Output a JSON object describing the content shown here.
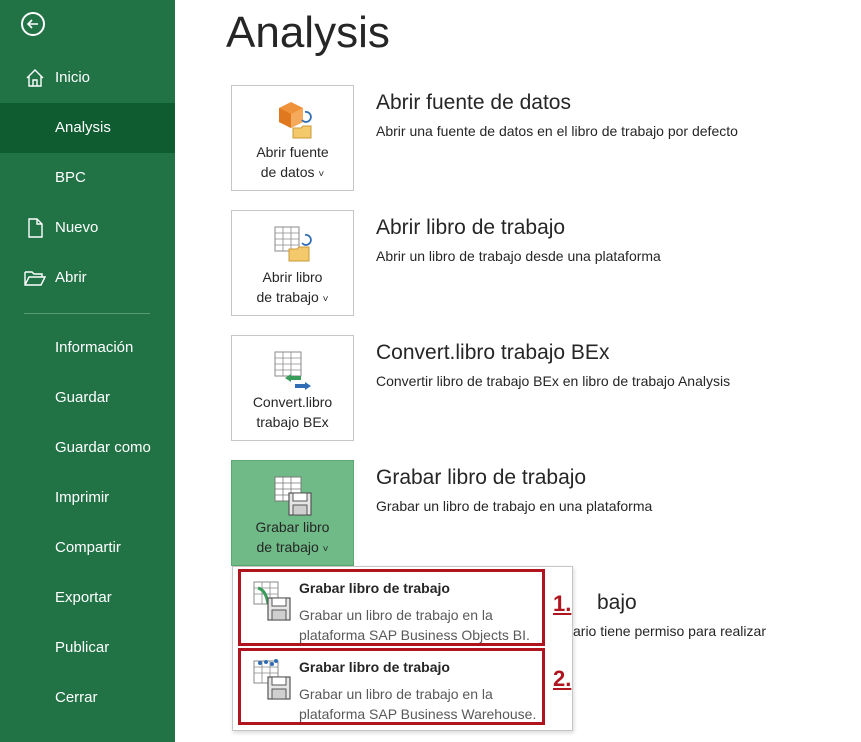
{
  "page_title": "Analysis",
  "sidebar": {
    "back_label": "",
    "items": [
      {
        "label": "Inicio",
        "icon": "home-icon"
      },
      {
        "label": "Analysis",
        "active": true
      },
      {
        "label": "BPC"
      },
      {
        "label": "Nuevo",
        "icon": "new-file-icon"
      },
      {
        "label": "Abrir",
        "icon": "folder-open-icon"
      },
      {
        "label": "Información"
      },
      {
        "label": "Guardar"
      },
      {
        "label": "Guardar como"
      },
      {
        "label": "Imprimir"
      },
      {
        "label": "Compartir"
      },
      {
        "label": "Exportar"
      },
      {
        "label": "Publicar"
      },
      {
        "label": "Cerrar"
      }
    ]
  },
  "actions": [
    {
      "tile_line1": "Abrir fuente",
      "tile_line2": "de datos",
      "has_caret": true,
      "title": "Abrir fuente de datos",
      "desc": "Abrir una fuente de datos en el libro de trabajo por defecto",
      "icon": "open-data-source-icon"
    },
    {
      "tile_line1": "Abrir libro",
      "tile_line2": "de trabajo",
      "has_caret": true,
      "title": "Abrir libro de trabajo",
      "desc": "Abrir un libro de trabajo desde una plataforma",
      "icon": "open-workbook-icon"
    },
    {
      "tile_line1": "Convert.libro",
      "tile_line2": "trabajo BEx",
      "has_caret": false,
      "title": "Convert.libro trabajo BEx",
      "desc": "Convertir libro de trabajo BEx en libro de trabajo Analysis",
      "icon": "convert-workbook-icon"
    },
    {
      "tile_line1": "Grabar libro",
      "tile_line2": "de trabajo",
      "has_caret": true,
      "title": "Grabar libro de trabajo",
      "desc": "Grabar un libro de trabajo en una plataforma",
      "icon": "save-workbook-icon",
      "selected": true
    }
  ],
  "hidden_action": {
    "title_fragment": "bajo",
    "desc_fragment": "ario tiene permiso para realizar"
  },
  "caret_glyph": "˅",
  "dropdown": {
    "items": [
      {
        "title": "Grabar libro de trabajo",
        "desc_line1": "Grabar un libro de trabajo en la",
        "desc_line2": "plataforma SAP Business Objects BI.",
        "marker": "1.",
        "icon": "save-bi-platform-icon"
      },
      {
        "title": "Grabar libro de trabajo",
        "desc_line1": "Grabar un libro de trabajo en la",
        "desc_line2": "plataforma SAP Business Warehouse.",
        "marker": "2.",
        "icon": "save-bw-platform-icon"
      }
    ]
  },
  "colors": {
    "sidebar_bg": "#217346",
    "sidebar_active": "#0e5c2f",
    "tile_selected": "#6fba86",
    "highlight_red": "#b0151f"
  }
}
